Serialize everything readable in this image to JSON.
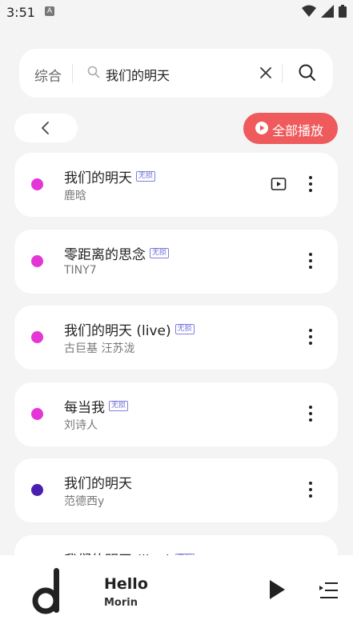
{
  "status_bar": {
    "time": "3:51",
    "notif": "A"
  },
  "search": {
    "type_label": "综合",
    "query": "我们的明天"
  },
  "toolbar": {
    "play_all_label": "全部播放"
  },
  "songs": [
    {
      "title": "我们的明天",
      "artist": "鹿晗",
      "badge": "无损",
      "dot_color": "#e535d6",
      "has_mv": true
    },
    {
      "title": "零距离的思念",
      "artist": "TINY7",
      "badge": "无损",
      "dot_color": "#e535d6",
      "has_mv": false
    },
    {
      "title": "我们的明天 (live)",
      "artist": "古巨基 汪苏泷",
      "badge": "无损",
      "dot_color": "#e535d6",
      "has_mv": false
    },
    {
      "title": "每当我",
      "artist": "刘诗人",
      "badge": "无损",
      "dot_color": "#e535d6",
      "has_mv": false
    },
    {
      "title": "我们的明天",
      "artist": "范德西y",
      "badge": "",
      "dot_color": "#4a1fb0",
      "has_mv": false
    },
    {
      "title": "我们的明天 (live)",
      "artist": "",
      "badge": "无损",
      "dot_color": "#e535d6",
      "has_mv": false
    }
  ],
  "player": {
    "title": "Hello",
    "artist": "Morin"
  },
  "colors": {
    "accent": "#ef5a5c",
    "badge": "#6d6dd6",
    "background": "#f4f4f4"
  }
}
